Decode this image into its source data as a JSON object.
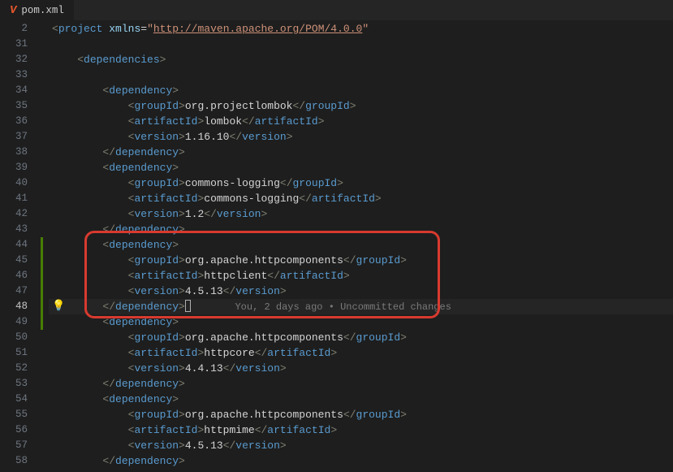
{
  "tab": {
    "icon": "V",
    "title": "pom.xml"
  },
  "lineNumbers": [
    "2",
    "31",
    "32",
    "33",
    "34",
    "35",
    "36",
    "37",
    "38",
    "39",
    "40",
    "41",
    "42",
    "43",
    "44",
    "45",
    "46",
    "47",
    "48",
    "49",
    "50",
    "51",
    "52",
    "53",
    "54",
    "55",
    "56",
    "57",
    "58"
  ],
  "currentLine": 48,
  "lens": "You, 2 days ago • Uncommitted changes",
  "xml": {
    "projectTag": "project",
    "xmlnsAttr": "xmlns",
    "xmlnsUrl": "http://maven.apache.org/POM/4.0.0",
    "dependenciesTag": "dependencies",
    "dependencyTag": "dependency",
    "groupIdTag": "groupId",
    "artifactIdTag": "artifactId",
    "versionTag": "version",
    "deps": [
      {
        "groupId": "org.projectlombok",
        "artifactId": "lombok",
        "version": "1.16.10"
      },
      {
        "groupId": "commons-logging",
        "artifactId": "commons-logging",
        "version": "1.2"
      },
      {
        "groupId": "org.apache.httpcomponents",
        "artifactId": "httpclient",
        "version": "4.5.13"
      },
      {
        "groupId": "org.apache.httpcomponents",
        "artifactId": "httpcore",
        "version": "4.4.13"
      },
      {
        "groupId": "org.apache.httpcomponents",
        "artifactId": "httpmime",
        "version": "4.5.13"
      }
    ]
  }
}
